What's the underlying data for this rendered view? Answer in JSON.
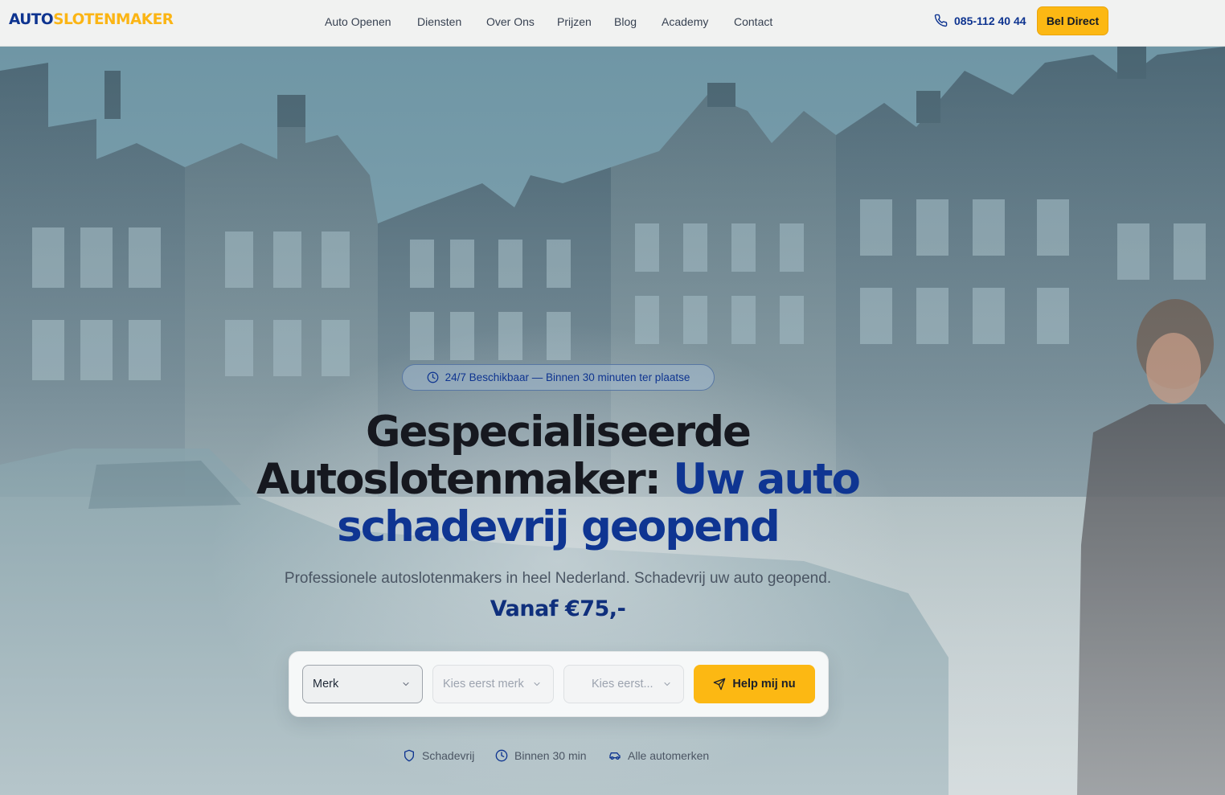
{
  "header": {
    "logo_part1": "AUTO",
    "logo_part2": "SLOTENMAKER",
    "nav": [
      "Auto Openen",
      "Diensten",
      "Over Ons",
      "Prijzen",
      "Blog",
      "Academy",
      "Contact"
    ],
    "phone": "085-112 40 44",
    "cta": "Bel Direct"
  },
  "hero": {
    "badge": "24/7 Beschikbaar — Binnen 30 minuten ter plaatse",
    "title_line1": "Gespecialiseerde",
    "title_line2_dark": "Autoslotenmaker: ",
    "title_line2_accent": "Uw auto",
    "title_line3": "schadevrij geopend",
    "subtitle": "Professionele autoslotenmakers in heel Nederland. Schadevrij uw auto geopend.",
    "price": "Vanaf €75,-"
  },
  "form": {
    "brand_select": "Merk",
    "model_select": "Kies eerst merk",
    "year_select": "Kies eerst...",
    "submit": "Help mij nu"
  },
  "features": [
    "Schadevrij",
    "Binnen 30 min",
    "Alle automerken"
  ],
  "colors": {
    "brand_blue": "#0e3490",
    "brand_yellow": "#fcb813",
    "text_dark": "#16181f"
  },
  "icons": {
    "phone": "phone-icon",
    "badge": "clock-icon",
    "submit": "send-icon",
    "features": [
      "shield-icon",
      "clock-icon",
      "car-icon"
    ]
  }
}
